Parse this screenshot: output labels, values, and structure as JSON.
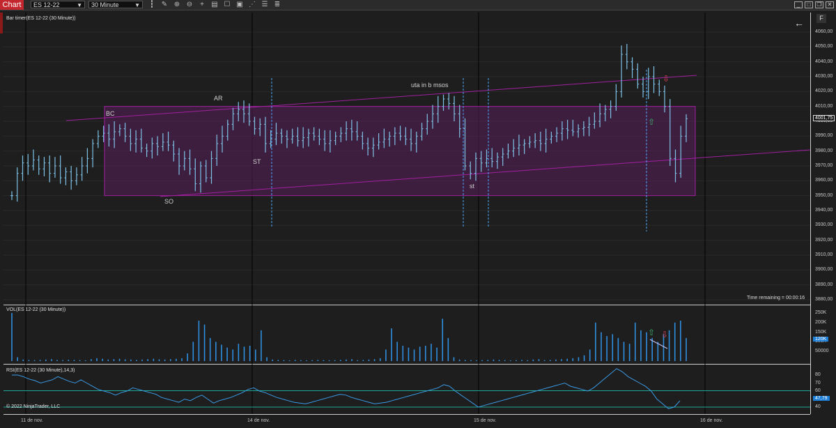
{
  "toolbar": {
    "tab_label": "Chart",
    "instrument": "ES 12-22",
    "interval": "30 Minute"
  },
  "main": {
    "title": "Bar timer(ES 12-22 (30 Minute))",
    "price_ticks": [
      "4060,00",
      "4050,00",
      "4040,00",
      "4030,00",
      "4020,00",
      "4010,00",
      "4000,00",
      "3990,00",
      "3980,00",
      "3970,00",
      "3960,00",
      "3950,00",
      "3940,00",
      "3930,00",
      "3920,00",
      "3910,00",
      "3900,00",
      "3890,00",
      "3880,00"
    ],
    "last_price": "4001,75",
    "time_remaining": "Time remaining = 00:00:16",
    "annotations": {
      "bc": "BC",
      "ar": "AR",
      "so": "SO",
      "st_upper": "ST",
      "uta": "uta in b msos",
      "st_lower": "st"
    },
    "panel_button": "F"
  },
  "volume_panel": {
    "title": "VOL(ES 12-22 (30 Minute))",
    "ticks": [
      "250K",
      "200K",
      "150K",
      "100K",
      "50000"
    ],
    "last_value": "120K"
  },
  "rsi_panel": {
    "title": "RSI(ES 12-22 (30 Minute),14,3)",
    "ticks": [
      "80",
      "70",
      "60",
      "50",
      "40"
    ],
    "last_value": "47,79",
    "copyright": "© 2022 NinjaTrader, LLC"
  },
  "dates": [
    "11 de nov.",
    "14 de nov.",
    "15 de nov.",
    "16 de nov."
  ],
  "colors": {
    "bars": "#7fc3e8",
    "range_box": "#5a1f5a",
    "range_border": "#a020a0",
    "volume": "#2f8fe0",
    "rsi": "#3a9be6",
    "rsi_levels": "#1fa89a",
    "tab_red": "#c4262e",
    "up_arrow": "#3cb371",
    "down_arrow": "#e0405a"
  },
  "icons": [
    "bars-icon",
    "pencil-icon",
    "zoom-in-icon",
    "zoom-out-icon",
    "crosshair-icon",
    "properties-icon",
    "data-box-icon",
    "screenshot-icon",
    "strategy-icon",
    "indicators-icon",
    "back-arrow-icon",
    "up-arrow-icon",
    "down-arrow-icon"
  ],
  "chart_data": {
    "type": "ohlc",
    "series": [
      {
        "name": "ES 12-22 (30 Minute)",
        "close": [
          3950,
          3965,
          3972,
          3970,
          3974,
          3968,
          3972,
          3965,
          3970,
          3962,
          3966,
          3960,
          3964,
          3970,
          3975,
          3985,
          3990,
          3992,
          3988,
          3993,
          3995,
          3990,
          3985,
          3988,
          3982,
          3980,
          3985,
          3983,
          3986,
          3984,
          3978,
          3970,
          3975,
          3968,
          3958,
          3970,
          3962,
          3975,
          3985,
          3990,
          3998,
          4005,
          4008,
          4005,
          4000,
          3995,
          3998,
          3985,
          3988,
          3992,
          3990,
          3988,
          3990,
          3987,
          3989,
          3992,
          3990,
          3988,
          3985,
          3987,
          3990,
          3992,
          3995,
          3993,
          3990,
          3985,
          3982,
          3984,
          3986,
          3988,
          3990,
          3992,
          3990,
          3988,
          3985,
          3990,
          3995,
          4000,
          4005,
          4010,
          4015,
          4012,
          4005,
          3995,
          3970,
          3965,
          3975,
          3972,
          3975,
          3973,
          3976,
          3978,
          3980,
          3982,
          3984,
          3985,
          3986,
          3987,
          3985,
          3988,
          3990,
          3992,
          3995,
          3994,
          3993,
          3995,
          3996,
          3998,
          4000,
          4005,
          4008,
          4010,
          4020,
          4045,
          4040,
          4035,
          4025,
          4020,
          4030,
          4025,
          4020,
          4010,
          3975,
          3965,
          3990,
          4001.75
        ]
      }
    ],
    "ylim": [
      3880,
      4065
    ],
    "volume": [
      250,
      20,
      8,
      6,
      5,
      6,
      8,
      10,
      6,
      5,
      7,
      6,
      5,
      4,
      10,
      15,
      12,
      8,
      10,
      12,
      9,
      8,
      6,
      8,
      10,
      12,
      9,
      8,
      10,
      12,
      15,
      40,
      100,
      210,
      190,
      120,
      100,
      85,
      70,
      60,
      90,
      75,
      80,
      60,
      160,
      20,
      8,
      6,
      5,
      4,
      6,
      5,
      4,
      5,
      6,
      5,
      4,
      5,
      6,
      8,
      10,
      5,
      6,
      8,
      10,
      15,
      60,
      170,
      100,
      80,
      70,
      60,
      75,
      80,
      90,
      70,
      220,
      120,
      20,
      8,
      6,
      5,
      4,
      5,
      6,
      8,
      6,
      5,
      4,
      5,
      6,
      5,
      8,
      10,
      5,
      6,
      8,
      10,
      12,
      15,
      20,
      30,
      60,
      200,
      150,
      130,
      140,
      120,
      100,
      90,
      200,
      160,
      150,
      120,
      100,
      140,
      160,
      200,
      210,
      120
    ],
    "rsi": [
      80,
      80,
      78,
      75,
      73,
      70,
      72,
      74,
      78,
      75,
      72,
      70,
      74,
      70,
      66,
      62,
      60,
      58,
      55,
      58,
      60,
      64,
      62,
      60,
      58,
      56,
      52,
      50,
      48,
      46,
      50,
      48,
      52,
      55,
      50,
      45,
      48,
      50,
      52,
      55,
      58,
      62,
      64,
      60,
      58,
      55,
      52,
      50,
      48,
      46,
      45,
      44,
      46,
      48,
      50,
      52,
      54,
      56,
      55,
      52,
      50,
      48,
      46,
      44,
      45,
      46,
      48,
      50,
      52,
      54,
      56,
      58,
      60,
      62,
      64,
      68,
      66,
      60,
      55,
      50,
      45,
      40,
      42,
      44,
      46,
      48,
      50,
      52,
      54,
      56,
      58,
      60,
      62,
      64,
      66,
      68,
      70,
      66,
      64,
      62,
      60,
      64,
      70,
      76,
      82,
      88,
      84,
      78,
      74,
      70,
      66,
      60,
      50,
      44,
      38,
      40,
      47.79
    ],
    "rsi_levels": [
      70,
      40
    ],
    "range_box": {
      "top": 4010,
      "bottom": 3950
    }
  }
}
